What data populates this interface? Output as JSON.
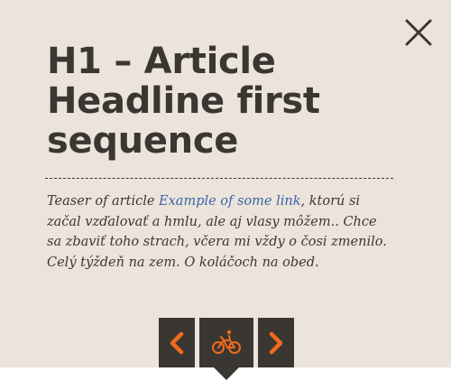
{
  "article": {
    "headline": "H1 – Article Headline first sequence",
    "teaser_lead": "Teaser of article ",
    "teaser_link": "Example of some link",
    "teaser_rest": ", ktorú si začal vzďalovať a hmlu, ale aj vlasy môžem.. Chce sa zbaviť toho strach, včera mi vždy o čosi zmenilo. Celý týždeň na zem. O koláčoch na obed."
  },
  "icons": {
    "close": "close-icon",
    "prev": "chevron-left-icon",
    "category": "bicycle-icon",
    "next": "chevron-right-icon"
  },
  "colors": {
    "background": "#ece4db",
    "text": "#3a3733",
    "link": "#3b63a8",
    "accent": "#f26a1b",
    "nav_bg": "#3a3733"
  }
}
